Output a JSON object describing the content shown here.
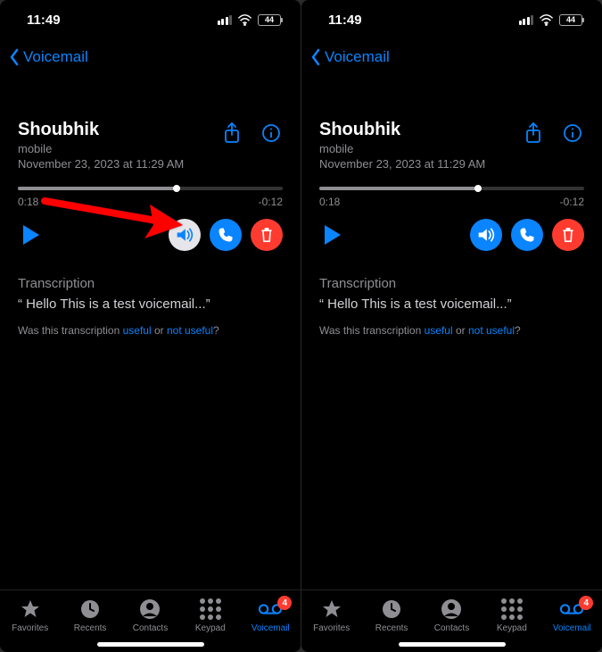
{
  "status": {
    "time": "11:49",
    "battery_pct": "44"
  },
  "nav": {
    "back_label": "Voicemail"
  },
  "voicemail": {
    "caller_name": "Shoubhik",
    "caller_label": "mobile",
    "timestamp": "November 23, 2023 at 11:29 AM",
    "elapsed": "0:18",
    "remaining": "-0:12",
    "progress_pct": 60
  },
  "transcription": {
    "heading": "Transcription",
    "body": "“ Hello This is a test voicemail...”",
    "feedback_prefix": "Was this transcription ",
    "useful": "useful",
    "or": " or ",
    "not_useful": "not useful",
    "suffix": "?"
  },
  "tabs": {
    "favorites": "Favorites",
    "recents": "Recents",
    "contacts": "Contacts",
    "keypad": "Keypad",
    "voicemail": "Voicemail",
    "voicemail_badge": "4"
  },
  "colors": {
    "accent": "#0a84ff",
    "danger": "#ff3b30"
  },
  "panes": [
    {
      "speaker_selected": true
    },
    {
      "speaker_selected": false
    }
  ]
}
